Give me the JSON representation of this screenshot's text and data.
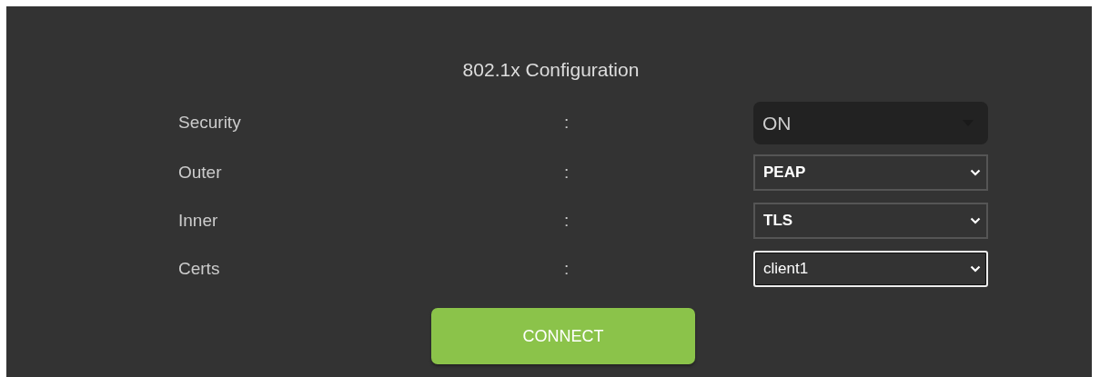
{
  "title": "802.1x Configuration",
  "fields": [
    {
      "label": "Security",
      "separator": ":",
      "value": "ON",
      "kind": "styled",
      "focused": false
    },
    {
      "label": "Outer",
      "separator": ":",
      "value": "PEAP",
      "kind": "native",
      "focused": false
    },
    {
      "label": "Inner",
      "separator": ":",
      "value": "TLS",
      "kind": "native",
      "focused": false
    },
    {
      "label": "Certs",
      "separator": ":",
      "value": "client1",
      "kind": "native",
      "focused": true
    }
  ],
  "button": "CONNECT"
}
